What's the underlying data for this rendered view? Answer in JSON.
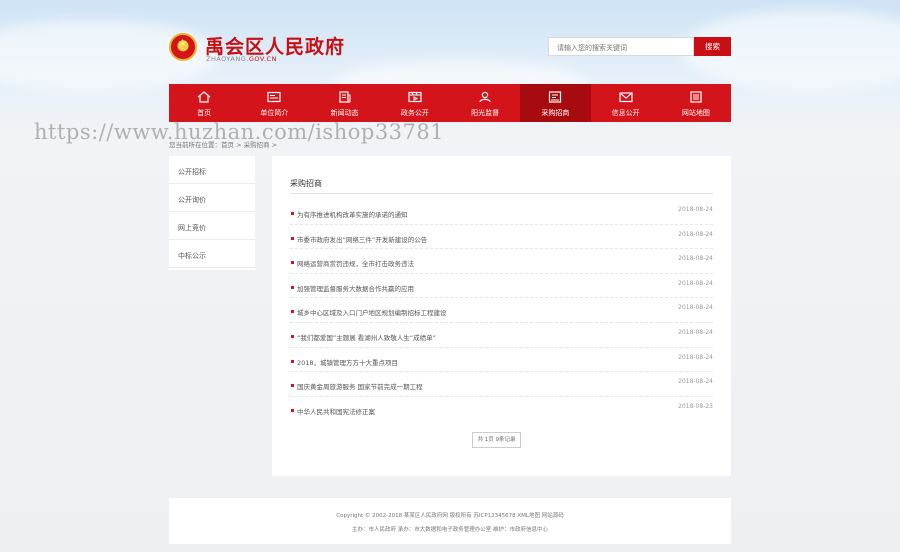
{
  "watermark": "https://www.huzhan.com/ishop33781",
  "header": {
    "title": "禹会区人民政府",
    "domain_prefix": "ZHAOYANG.",
    "domain_suffix": "GOV.CN",
    "search_placeholder": "请输入您的搜索关键词",
    "search_button": "搜索"
  },
  "nav": [
    {
      "label": "首页",
      "icon": "home-icon"
    },
    {
      "label": "单位简介",
      "icon": "id-card-icon"
    },
    {
      "label": "新闻动态",
      "icon": "newspaper-icon"
    },
    {
      "label": "政务公开",
      "icon": "film-icon"
    },
    {
      "label": "阳光监督",
      "icon": "people-icon"
    },
    {
      "label": "采购招商",
      "icon": "doc-icon"
    },
    {
      "label": "信息公开",
      "icon": "mail-icon"
    },
    {
      "label": "网站地图",
      "icon": "list-icon"
    }
  ],
  "active_nav": 5,
  "breadcrumb": "您当前所在位置：首页 > 采购招商 >",
  "sidebar": [
    "公开招标",
    "公开询价",
    "网上竞价",
    "中标公示"
  ],
  "main": {
    "title": "采购招商",
    "items": [
      {
        "title": "为有序推进机构改革实施的承诺的通知",
        "date": "2018-08-24"
      },
      {
        "title": "市委市政府发出“网络三件”开发新建设的公告",
        "date": "2018-08-24"
      },
      {
        "title": "网络运营商赏罚违规，全市打击政务违法",
        "date": "2018-08-24"
      },
      {
        "title": "加强管理监督服务大数据合作共赢的应用",
        "date": "2018-08-24"
      },
      {
        "title": "城乡中心区域及入口门户地区规划编制招标工程建设",
        "date": "2018-08-24"
      },
      {
        "title": "“我们都爱国”主题展 看湖州人致敬人生“成绩单”",
        "date": "2018-08-24"
      },
      {
        "title": "2018，城镇管理方方十大重点项目",
        "date": "2018-08-24"
      },
      {
        "title": "国庆黄金周旅游服务 国家节前完成一期工程",
        "date": "2018-08-24"
      },
      {
        "title": "中华人民共和国宪法修正案",
        "date": "2018-08-23"
      }
    ],
    "pager": "共 1页 9条记录"
  },
  "footer": {
    "line1": "Copyright © 2002-2018 某某区人民政府网 版权所有 苏ICP12345678 XML地图 网站源码",
    "line2": "主办：市人民政府 承办：市大数据和电子政务管理办公室 维护：市政府信息中心"
  },
  "colors": {
    "primary_red": "#d3141a",
    "active_red": "#a70b0f"
  }
}
